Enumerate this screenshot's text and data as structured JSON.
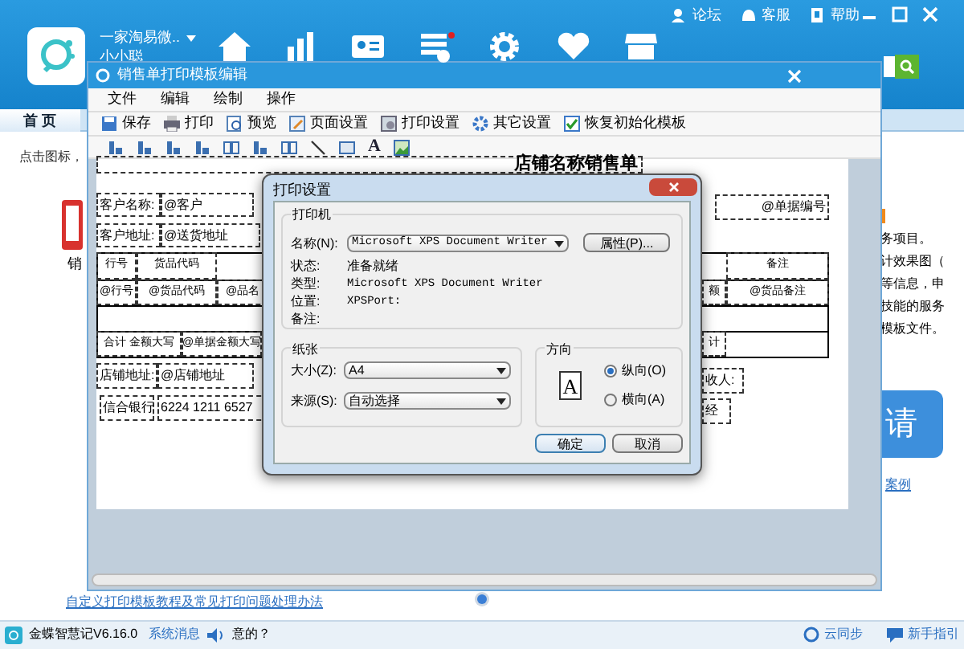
{
  "header": {
    "account": "一家淘易微..",
    "user": "小小聪",
    "links": [
      {
        "kind": "forum",
        "label": "论坛"
      },
      {
        "kind": "service",
        "label": "客服"
      },
      {
        "kind": "help",
        "label": "帮助"
      }
    ],
    "nav": [
      {
        "kind": "home",
        "alert": false
      },
      {
        "kind": "chart",
        "alert": false
      },
      {
        "kind": "card",
        "alert": false
      },
      {
        "kind": "bill",
        "alert": true
      },
      {
        "kind": "gear",
        "alert": false
      },
      {
        "kind": "heart",
        "alert": false
      },
      {
        "kind": "store",
        "alert": false
      }
    ]
  },
  "tabs": [
    {
      "label": "首 页",
      "selected": true
    }
  ],
  "home": {
    "hint": "点击图标，",
    "shortcut": "销",
    "notes": [
      "务项目。",
      "计效果图（",
      "等信息，申",
      "技能的服务",
      "模板文件。"
    ],
    "apply_button": "请",
    "case_link": "案例",
    "help_link": "自定义打印模板教程及常见打印问题处理办法"
  },
  "editor": {
    "title": "销售单打印模板编辑",
    "menu": [
      "文件",
      "编辑",
      "绘制",
      "操作"
    ],
    "toolbar": [
      {
        "kind": "save",
        "label": "保存"
      },
      {
        "kind": "print",
        "label": "打印"
      },
      {
        "kind": "preview",
        "label": "预览"
      },
      {
        "kind": "page",
        "label": "页面设置"
      },
      {
        "kind": "print_settings",
        "label": "打印设置"
      },
      {
        "kind": "gear",
        "label": "其它设置"
      },
      {
        "kind": "check",
        "label": "恢复初始化模板"
      }
    ],
    "draw_tools": [
      {
        "kind": "align"
      },
      {
        "kind": "align"
      },
      {
        "kind": "align"
      },
      {
        "kind": "align"
      },
      {
        "kind": "columns"
      },
      {
        "kind": "align"
      },
      {
        "kind": "columns"
      },
      {
        "kind": "line"
      },
      {
        "kind": "rectangle"
      },
      {
        "kind": "text",
        "glyph": "A"
      },
      {
        "kind": "image"
      }
    ],
    "template": [
      {
        "kind": "title",
        "text": "店铺名称销售单"
      },
      {
        "kind": "field",
        "text": "客户名称:"
      },
      {
        "kind": "field",
        "text": "@客户"
      },
      {
        "kind": "field",
        "text": "客户地址:"
      },
      {
        "kind": "field",
        "text": "@送货地址"
      },
      {
        "kind": "field",
        "text": "@单据编号"
      },
      {
        "kind": "cell",
        "text": "行号"
      },
      {
        "kind": "cell",
        "text": "货品代码"
      },
      {
        "kind": "cell",
        "text": "备注"
      },
      {
        "kind": "cell",
        "text": "@行号"
      },
      {
        "kind": "cell",
        "text": "@货品代码"
      },
      {
        "kind": "cell",
        "text": "@品名"
      },
      {
        "kind": "cell",
        "text": "额"
      },
      {
        "kind": "cell",
        "text": "@货品备注"
      },
      {
        "kind": "cell",
        "text": "合计 金额大写"
      },
      {
        "kind": "cell",
        "text": "@单据金额大写"
      },
      {
        "kind": "cell",
        "text": "计"
      },
      {
        "kind": "field",
        "text": "店铺地址:"
      },
      {
        "kind": "field",
        "text": "@店铺地址"
      },
      {
        "kind": "field",
        "text": "收人:"
      },
      {
        "kind": "field",
        "text": "信合银行"
      },
      {
        "kind": "field",
        "text": "6224 1211 6527"
      },
      {
        "kind": "field",
        "text": "经"
      }
    ]
  },
  "dialog": {
    "title": "打印设置",
    "printer": {
      "group": "打印机",
      "name_label": "名称(N):",
      "name": "Microsoft XPS Document Writer",
      "properties": "属性(P)...",
      "info": [
        {
          "label": "状态:",
          "value": "准备就绪"
        },
        {
          "label": "类型:",
          "value": "Microsoft XPS Document Writer"
        },
        {
          "label": "位置:",
          "value": "XPSPort:"
        },
        {
          "label": "备注:"
        }
      ]
    },
    "paper": {
      "group": "纸张",
      "size_label": "大小(Z):",
      "size": "A4",
      "source_label": "来源(S):",
      "source": "自动选择"
    },
    "orientation": {
      "group": "方向",
      "preview": "A",
      "options": [
        {
          "label": "纵向(O)",
          "selected": true
        },
        {
          "label": "横向(A)",
          "selected": false
        }
      ]
    },
    "buttons": [
      "确定",
      "取消"
    ]
  },
  "status": {
    "app": "金蝶智慧记V6.16.0",
    "messages": "系统消息",
    "ticker": "意的？",
    "sync": "云同步",
    "guide": "新手指引"
  }
}
